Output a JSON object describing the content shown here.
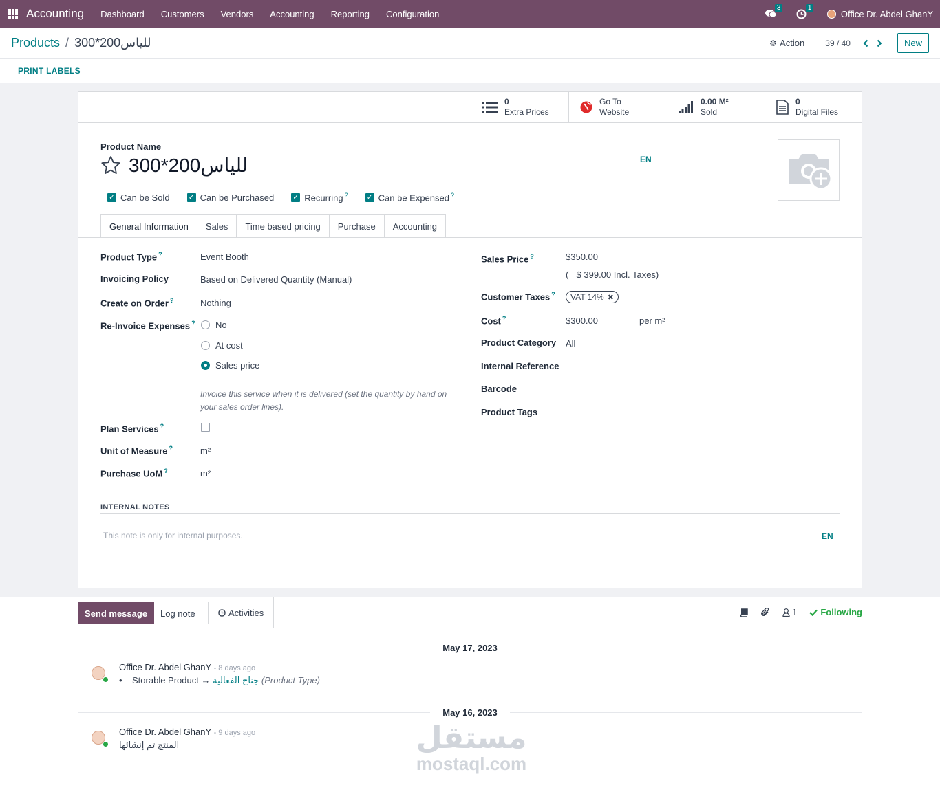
{
  "topbar": {
    "app_name": "Accounting",
    "menu": [
      "Dashboard",
      "Customers",
      "Vendors",
      "Accounting",
      "Reporting",
      "Configuration"
    ],
    "messages_count": "3",
    "activities_count": "1",
    "user_name": "Office Dr. Abdel GhanY"
  },
  "control_panel": {
    "breadcrumb_parent": "Products",
    "breadcrumb_sep": "/",
    "breadcrumb_current": "للياس200*300",
    "action_label": "Action",
    "pager": "39 / 40",
    "new_label": "New",
    "print_labels": "PRINT LABELS"
  },
  "stat_buttons": [
    {
      "value": "0",
      "label": "Extra Prices",
      "icon": "list-icon"
    },
    {
      "value": "Go To",
      "label": "Website",
      "icon": "globe-icon"
    },
    {
      "value": "0.00 M²",
      "label": "Sold",
      "icon": "signal-icon"
    },
    {
      "value": "0",
      "label": "Digital Files",
      "icon": "file-icon"
    }
  ],
  "product": {
    "name_label": "Product Name",
    "name": "للياس200*300",
    "lang": "EN",
    "flags": [
      {
        "label": "Can be Sold",
        "checked": true,
        "help": ""
      },
      {
        "label": "Can be Purchased",
        "checked": true,
        "help": ""
      },
      {
        "label": "Recurring",
        "checked": true,
        "help": "?"
      },
      {
        "label": "Can be Expensed",
        "checked": true,
        "help": "?"
      }
    ]
  },
  "tabs": [
    "General Information",
    "Sales",
    "Time based pricing",
    "Purchase",
    "Accounting"
  ],
  "general": {
    "product_type_label": "Product Type",
    "product_type": "Event Booth",
    "invoicing_policy_label": "Invoicing Policy",
    "invoicing_policy": "Based on Delivered Quantity (Manual)",
    "create_on_order_label": "Create on Order",
    "create_on_order": "Nothing",
    "reinvoice_label": "Re-Invoice Expenses",
    "reinvoice_options": [
      "No",
      "At cost",
      "Sales price"
    ],
    "reinvoice_selected": "Sales price",
    "help_text": "Invoice this service when it is delivered (set the quantity by hand on your sales order lines).",
    "plan_services_label": "Plan Services",
    "uom_label": "Unit of Measure",
    "uom": "m²",
    "purchase_uom_label": "Purchase UoM",
    "purchase_uom": "m²",
    "sales_price_label": "Sales Price",
    "sales_price": "$350.00",
    "sales_price_incl": "(= $ 399.00 Incl. Taxes)",
    "customer_taxes_label": "Customer Taxes",
    "customer_tax_tag": "VAT 14%",
    "cost_label": "Cost",
    "cost": "$300.00",
    "cost_unit": "per m²",
    "category_label": "Product Category",
    "category": "All",
    "internal_ref_label": "Internal Reference",
    "barcode_label": "Barcode",
    "tags_label": "Product Tags",
    "help_mark": "?"
  },
  "notes": {
    "heading": "INTERNAL NOTES",
    "placeholder": "This note is only for internal purposes.",
    "lang": "EN"
  },
  "chatter": {
    "send_message": "Send message",
    "log_note": "Log note",
    "activities": "Activities",
    "followers_count": "1",
    "following": "Following",
    "dates": [
      "May 17, 2023",
      "May 16, 2023"
    ],
    "messages": [
      {
        "author": "Office Dr. Abdel GhanY",
        "time": "- 8 days ago",
        "old": "Storable Product",
        "new": "جناح الفعالية",
        "field": "(Product Type)"
      },
      {
        "author": "Office Dr. Abdel GhanY",
        "time": "- 9 days ago",
        "body": "المنتج تم إنشائها"
      }
    ]
  },
  "watermark": {
    "ar": "مستقل",
    "en": "mostaql.com"
  }
}
